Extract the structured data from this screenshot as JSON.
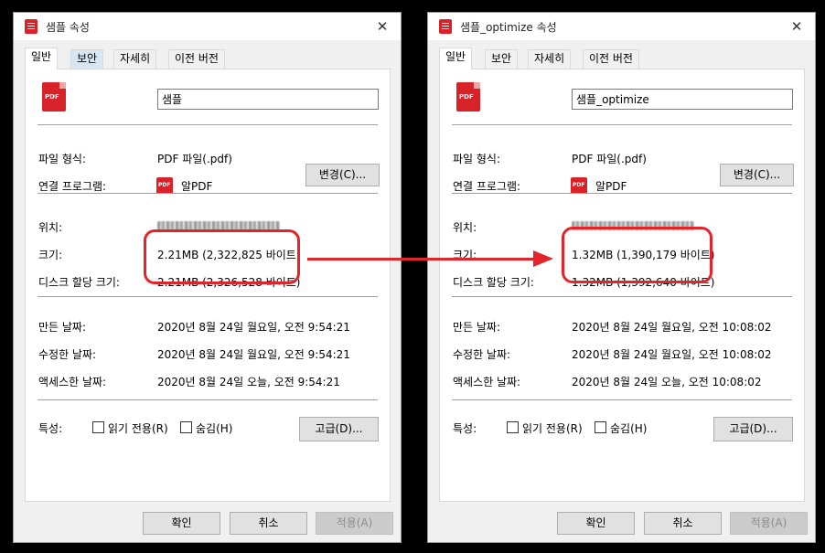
{
  "windows": {
    "left": {
      "title": "샘플 속성",
      "tabs": [
        "일반",
        "보안",
        "자세히",
        "이전 버전"
      ],
      "file_name": "샘플",
      "file_icon": "PDF",
      "file_type_label": "파일 형식:",
      "file_type_value": "PDF 파일(.pdf)",
      "open_with_label": "연결 프로그램:",
      "open_with_icon": "PDF",
      "open_with_value": "알PDF",
      "change_button": "변경(C)...",
      "location_label": "위치:",
      "size_label": "크기:",
      "size_value": "2.21MB (2,322,825 바이트)",
      "disk_size_label": "디스크 할당 크기:",
      "disk_size_value": "2.21MB (2,326,528 바이트)",
      "created_label": "만든 날짜:",
      "created_value": "2020년 8월 24일 월요일, 오전 9:54:21",
      "modified_label": "수정한 날짜:",
      "modified_value": "2020년 8월 24일 월요일, 오전 9:54:21",
      "accessed_label": "액세스한 날짜:",
      "accessed_value": "2020년 8월 24일 오늘, 오전 9:54:21",
      "attributes_label": "특성:",
      "readonly_label": "읽기 전용(R)",
      "hidden_label": "숨김(H)",
      "advanced_button": "고급(D)...",
      "ok_button": "확인",
      "cancel_button": "취소",
      "apply_button": "적용(A)"
    },
    "right": {
      "title": "샘플_optimize 속성",
      "tabs": [
        "일반",
        "보안",
        "자세히",
        "이전 버전"
      ],
      "file_name": "샘플_optimize",
      "file_icon": "PDF",
      "file_type_label": "파일 형식:",
      "file_type_value": "PDF 파일(.pdf)",
      "open_with_label": "연결 프로그램:",
      "open_with_icon": "PDF",
      "open_with_value": "알PDF",
      "change_button": "변경(C)...",
      "location_label": "위치:",
      "size_label": "크기:",
      "size_value": "1.32MB (1,390,179 바이트)",
      "disk_size_label": "디스크 할당 크기:",
      "disk_size_value": "1.32MB (1,392,640 바이트)",
      "created_label": "만든 날짜:",
      "created_value": "2020년 8월 24일 월요일, 오전 10:08:02",
      "modified_label": "수정한 날짜:",
      "modified_value": "2020년 8월 24일 월요일, 오전 10:08:02",
      "accessed_label": "액세스한 날짜:",
      "accessed_value": "2020년 8월 24일 오늘, 오전 10:08:02",
      "attributes_label": "특성:",
      "readonly_label": "읽기 전용(R)",
      "hidden_label": "숨김(H)",
      "advanced_button": "고급(D)...",
      "ok_button": "확인",
      "cancel_button": "취소",
      "apply_button": "적용(A)"
    }
  },
  "colors": {
    "highlight": "#e3242b",
    "pdf_icon": "#d8222a",
    "tab_hover": "#d8e6f2"
  },
  "icons": {
    "app": "pdf-file-icon",
    "close": "close-icon",
    "arrow": "arrow-right-icon"
  }
}
